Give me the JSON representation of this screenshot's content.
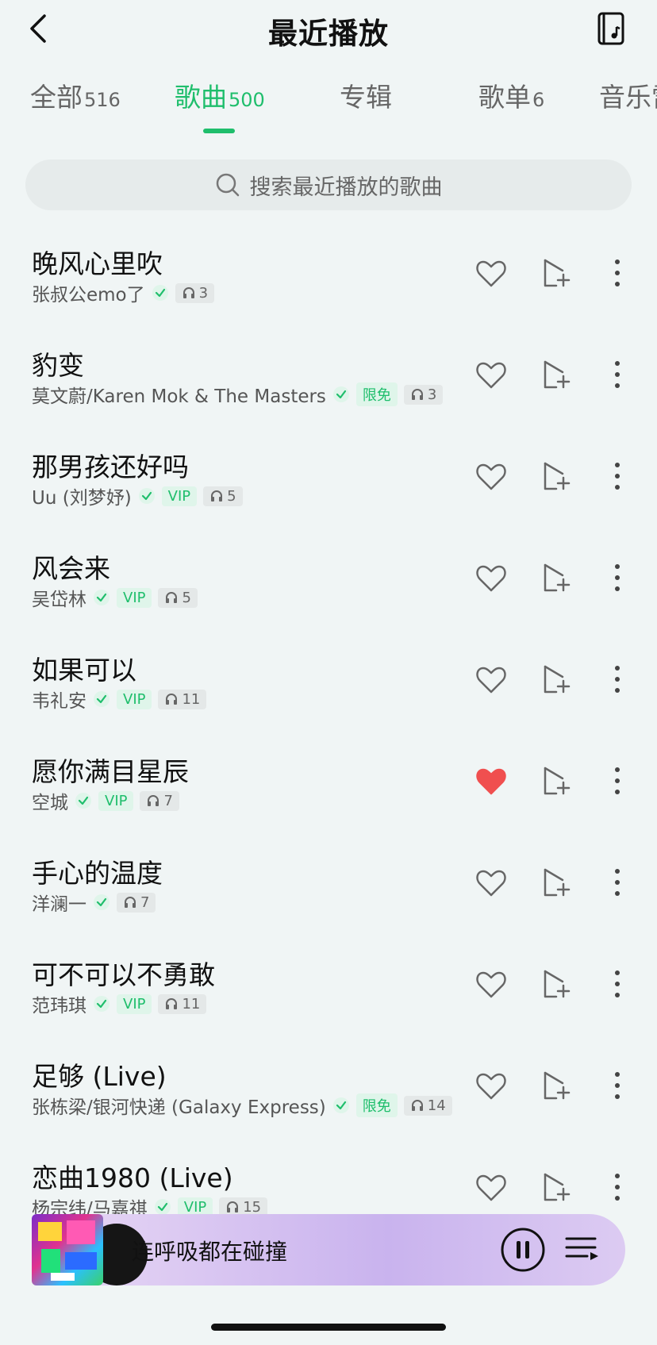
{
  "header": {
    "title": "最近播放"
  },
  "tabs": [
    {
      "label": "全部",
      "count": "516"
    },
    {
      "label": "歌曲",
      "count": "500"
    },
    {
      "label": "专辑",
      "count": ""
    },
    {
      "label": "歌单",
      "count": "6"
    },
    {
      "label": "音乐雷",
      "count": ""
    }
  ],
  "active_tab": "歌曲",
  "search": {
    "placeholder": "搜索最近播放的歌曲"
  },
  "songs": [
    {
      "title": "晚风心里吹",
      "artist": "张叔公emo了",
      "badge": "",
      "plays": "3",
      "liked": false
    },
    {
      "title": "豹变",
      "artist": "莫文蔚/Karen Mok & The Masters",
      "badge": "限免",
      "plays": "3",
      "liked": false
    },
    {
      "title": "那男孩还好吗",
      "artist": "Uu (刘梦妤)",
      "badge": "VIP",
      "plays": "5",
      "liked": false
    },
    {
      "title": "风会来",
      "artist": "吴岱林",
      "badge": "VIP",
      "plays": "5",
      "liked": false
    },
    {
      "title": "如果可以",
      "artist": "韦礼安",
      "badge": "VIP",
      "plays": "11",
      "liked": false
    },
    {
      "title": "愿你满目星辰",
      "artist": "空城",
      "badge": "VIP",
      "plays": "7",
      "liked": true
    },
    {
      "title": "手心的温度",
      "artist": "洋澜一",
      "badge": "",
      "plays": "7",
      "liked": false
    },
    {
      "title": "可不可以不勇敢",
      "artist": "范玮琪",
      "badge": "VIP",
      "plays": "11",
      "liked": false
    },
    {
      "title": "足够 (Live)",
      "artist": "张栋梁/银河快递 (Galaxy Express)",
      "badge": "限免",
      "plays": "14",
      "liked": false
    },
    {
      "title": "恋曲1980 (Live)",
      "artist": "杨宗纬/马嘉祺",
      "badge": "VIP",
      "plays": "15",
      "liked": false
    }
  ],
  "player": {
    "now_playing": "连呼吸都在碰撞"
  },
  "colors": {
    "accent": "#1fbe6c",
    "liked": "#f04f4f",
    "background": "#f0f5f5"
  },
  "icons": [
    "back-arrow-icon",
    "device-music-icon",
    "search-icon",
    "heart-icon",
    "add-to-playlist-icon",
    "more-vertical-icon",
    "verified-icon",
    "headphones-icon",
    "pause-icon",
    "queue-icon"
  ]
}
